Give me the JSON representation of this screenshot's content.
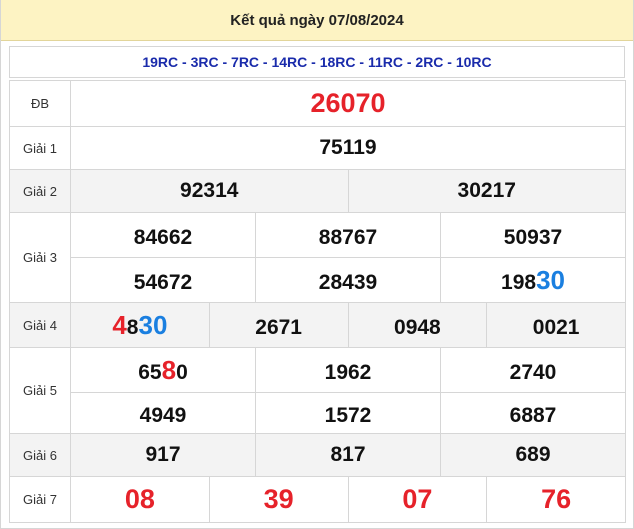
{
  "header": {
    "title": "Kết quả ngày 07/08/2024"
  },
  "codes": "19RC - 3RC - 7RC - 14RC - 18RC - 11RC - 2RC - 10RC",
  "labels": {
    "db": "ĐB",
    "g1": "Giải 1",
    "g2": "Giải 2",
    "g3": "Giải 3",
    "g4": "Giải 4",
    "g5": "Giải 5",
    "g6": "Giải 6",
    "g7": "Giải 7"
  },
  "results": {
    "db": "26070",
    "g1": "75119",
    "g2": [
      "92314",
      "30217"
    ],
    "g3": [
      {
        "plain": "84662",
        "hl": ""
      },
      {
        "plain": "88767",
        "hl": ""
      },
      {
        "plain": "50937",
        "hl": ""
      },
      {
        "plain": "54672",
        "hl": ""
      },
      {
        "plain": "28439",
        "hl": ""
      },
      {
        "plain": "198",
        "hl": "30"
      }
    ],
    "g4": [
      {
        "red": "4",
        "plain": "8",
        "hl": "30"
      },
      {
        "red": "",
        "plain": "2671",
        "hl": ""
      },
      {
        "red": "",
        "plain": "0948",
        "hl": ""
      },
      {
        "red": "",
        "plain": "0021",
        "hl": ""
      }
    ],
    "g5": [
      {
        "pre": "65",
        "red": "8",
        "post": "0"
      },
      {
        "pre": "1962",
        "red": "",
        "post": ""
      },
      {
        "pre": "2740",
        "red": "",
        "post": ""
      },
      {
        "pre": "4949",
        "red": "",
        "post": ""
      },
      {
        "pre": "1572",
        "red": "",
        "post": ""
      },
      {
        "pre": "6887",
        "red": "",
        "post": ""
      }
    ],
    "g6": [
      "917",
      "817",
      "689"
    ],
    "g7": [
      "08",
      "39",
      "07",
      "76"
    ]
  },
  "colors": {
    "header_bg": "#fdf3c3",
    "code_blue": "#1a2bab",
    "red": "#e6222a",
    "highlight_blue": "#1a7fe0",
    "alt_row": "#f3f3f3"
  }
}
